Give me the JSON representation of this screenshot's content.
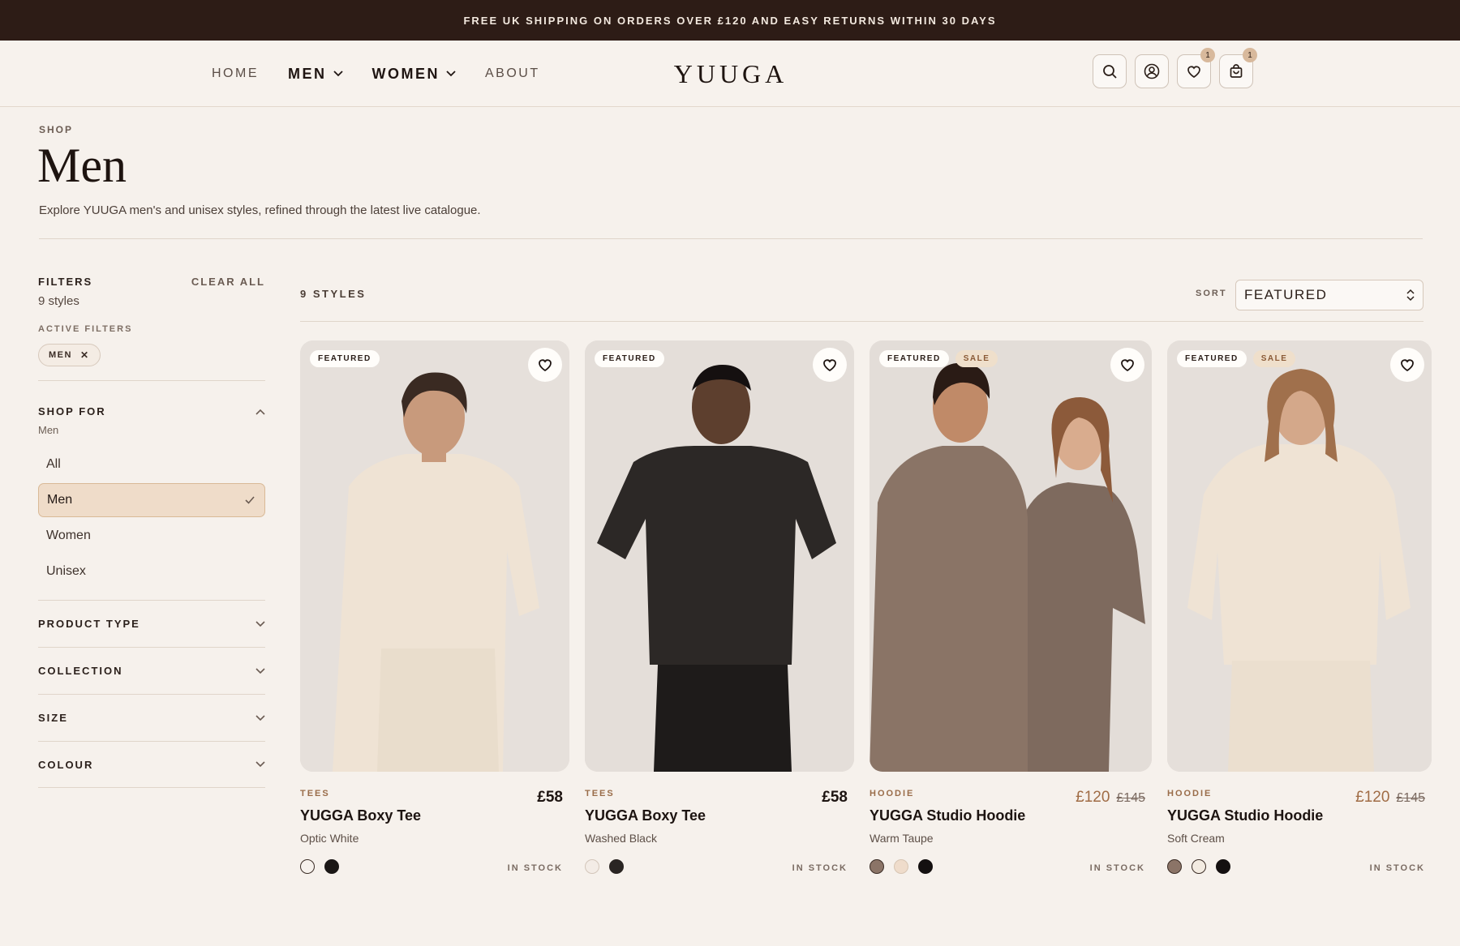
{
  "announcement": "FREE UK SHIPPING ON ORDERS OVER £120 AND EASY RETURNS WITHIN 30 DAYS",
  "nav": {
    "home": "HOME",
    "men": "MEN",
    "women": "WOMEN",
    "about": "ABOUT"
  },
  "brand": "YUUGA",
  "header_icons": {
    "wishlist_count": "1",
    "cart_count": "1"
  },
  "page": {
    "breadcrumb": "SHOP",
    "title": "Men",
    "description": "Explore YUUGA men's and unisex styles, refined through the latest live catalogue."
  },
  "filters": {
    "heading": "FILTERS",
    "clear_all": "CLEAR ALL",
    "count": "9 styles",
    "active_label": "ACTIVE FILTERS",
    "active_chip": "MEN",
    "shop_for": {
      "title": "SHOP FOR",
      "current": "Men",
      "options": [
        "All",
        "Men",
        "Women",
        "Unisex"
      ],
      "selected": "Men"
    },
    "sections": [
      "PRODUCT TYPE",
      "COLLECTION",
      "SIZE",
      "COLOUR"
    ]
  },
  "results": {
    "count": "9 STYLES",
    "sort_label": "SORT",
    "sort_value": "FEATURED"
  },
  "colors": {
    "announce_bg": "#2d1c16",
    "accent": "#d9b996",
    "sale": "#a06c45"
  },
  "products": [
    {
      "tags": [
        "FEATURED"
      ],
      "category": "TEES",
      "name": "YUGGA Boxy Tee",
      "variant": "Optic White",
      "price": "£58",
      "old_price": "",
      "stock": "IN STOCK",
      "swatches": [
        "#f6f1ec",
        "#1b1716"
      ]
    },
    {
      "tags": [
        "FEATURED"
      ],
      "category": "TEES",
      "name": "YUGGA Boxy Tee",
      "variant": "Washed Black",
      "price": "£58",
      "old_price": "",
      "stock": "IN STOCK",
      "swatches": [
        "#f3ece6",
        "#2a2523"
      ]
    },
    {
      "tags": [
        "FEATURED",
        "SALE"
      ],
      "category": "HOODIE",
      "name": "YUGGA Studio Hoodie",
      "variant": "Warm Taupe",
      "price": "£120",
      "old_price": "£145",
      "stock": "IN STOCK",
      "swatches": [
        "#8b7467",
        "#efdccb",
        "#141010"
      ]
    },
    {
      "tags": [
        "FEATURED",
        "SALE"
      ],
      "category": "HOODIE",
      "name": "YUGGA Studio Hoodie",
      "variant": "Soft Cream",
      "price": "£120",
      "old_price": "£145",
      "stock": "IN STOCK",
      "swatches": [
        "#8b7467",
        "#f3ebe1",
        "#141010"
      ]
    }
  ]
}
